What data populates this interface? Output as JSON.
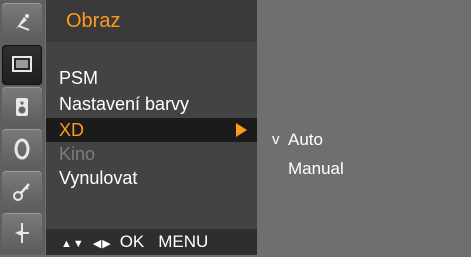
{
  "sidebar": {
    "icons": [
      {
        "name": "satellite-icon"
      },
      {
        "name": "picture-icon",
        "active": true
      },
      {
        "name": "speaker-icon"
      },
      {
        "name": "clock-icon"
      },
      {
        "name": "key-icon"
      },
      {
        "name": "input-icon"
      }
    ]
  },
  "menu": {
    "title": "Obraz",
    "items": [
      {
        "label": "PSM"
      },
      {
        "label": "Nastavení barvy"
      },
      {
        "label": "XD",
        "selected": true
      },
      {
        "label": "Kino",
        "disabled": true
      },
      {
        "label": "Vynulovat"
      }
    ]
  },
  "submenu": {
    "check_mark": "v",
    "items": [
      {
        "label": "Auto",
        "checked": true
      },
      {
        "label": "Manual"
      }
    ]
  },
  "footer": {
    "updown_glyph": "▲▼",
    "leftright_glyph": "◀▶",
    "ok_label": "OK",
    "menu_label": "MENU"
  },
  "colors": {
    "accent": "#ff9a1a",
    "panel": "#434343",
    "selected_bg": "#1b1b1b",
    "disabled_text": "#7d7d7d"
  }
}
